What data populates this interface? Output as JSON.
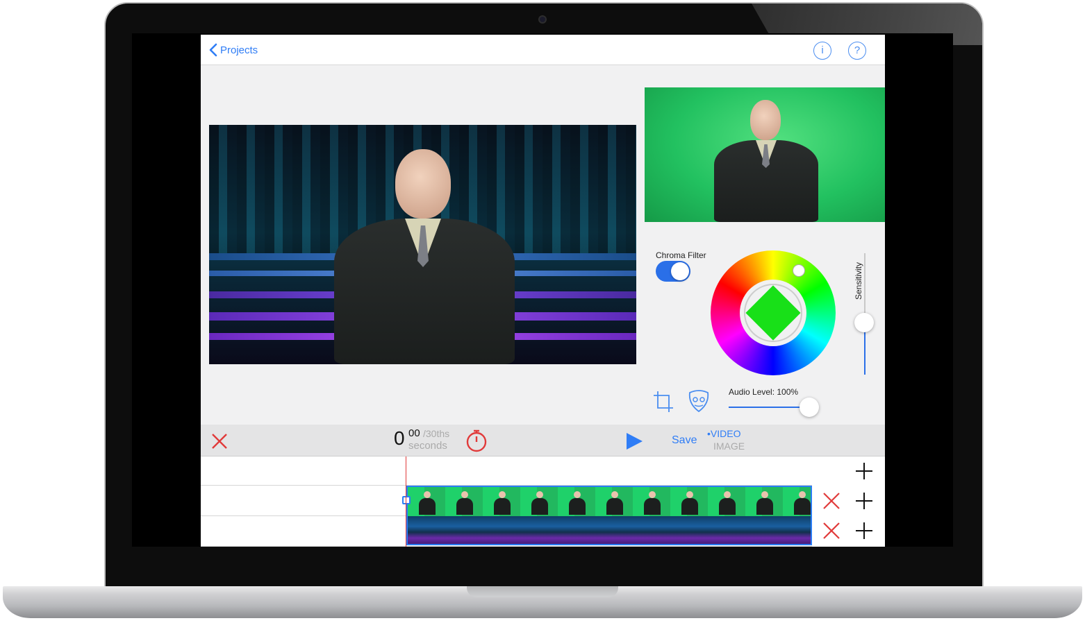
{
  "navbar": {
    "back_label": "Projects",
    "info_icon_glyph": "i",
    "help_icon_glyph": "?"
  },
  "controls": {
    "chroma_filter_label": "Chroma Filter",
    "chroma_filter_on": true,
    "sensitivity_label": "Sensitivity",
    "sensitivity_level": 0.43,
    "audio_level_label": "Audio Level: 100%",
    "audio_level": 1.0,
    "key_color": "#18e018"
  },
  "transport": {
    "seconds_value": "0",
    "frames_value": "00",
    "frames_unit": "/30ths",
    "seconds_label": "seconds",
    "save_label": "Save",
    "mode_video_label": "•VIDEO",
    "mode_image_label": "IMAGE"
  },
  "colors": {
    "accent": "#2f7df6",
    "delete": "#e13a3a",
    "chroma_green": "#22c160"
  },
  "timeline": {
    "tracks": [
      {
        "has_delete": false,
        "has_add": true
      },
      {
        "has_delete": true,
        "has_add": true
      },
      {
        "has_delete": true,
        "has_add": true
      }
    ]
  }
}
